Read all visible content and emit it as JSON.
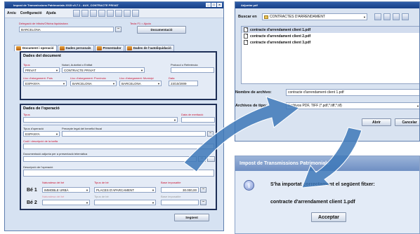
{
  "main_window": {
    "title": "Impost de Transmissions Patrimonials 2015 v3.7.1 - AUX_CONTRACTE PRIVAT",
    "menu": [
      "Arxiu",
      "Configuració",
      "Ajuda"
    ],
    "delegacio_label": "Delegació de tributs/Oficina liquidadora",
    "delegacio_value": "BARCELONA",
    "help_text": "Tecla F1 = Ajuda",
    "documentacio_button": "Documentació",
    "tabs": [
      "Document i operació",
      "Dades personals",
      "Presentador",
      "Dades de l'autoliquidació"
    ],
    "dades_document": {
      "title": "Dades del document",
      "tipus_label": "Tipus",
      "tipus_value": "PRIVAT",
      "notari_label": "Notari, Autoritat o Entitat",
      "notari_value": "CONTRACTE PRIVAT",
      "protocol_label": "Protocol o Referència",
      "lloc_pais_label": "Lloc d'atorgament: País",
      "lloc_pais_value": "ESPANYA",
      "lloc_prov_label": "Lloc d'atorgament: Província",
      "lloc_prov_value": "BARCELONA",
      "lloc_mun_label": "Lloc d'atorgament: Municipi",
      "lloc_mun_value": "BARCELONA",
      "data_label": "Data",
      "data_value": "23/10/2009"
    },
    "dades_operacio": {
      "title": "Dades de l'operació",
      "tipus_label": "Tipus",
      "data_meritacio_label": "Data de meritació",
      "tipus_operacio_label": "Tipus d'operació",
      "tipus_operacio_value": "ESPANYA",
      "precepte_label": "Precepte legal del benefici fiscal",
      "codi_label": "Codi i descripció de la tarifa",
      "doc_adjunta_label": "Documentació adjunta per a presentació telemàtica",
      "descripcio_label": "Descripció de l'operació",
      "naturalesa_label": "Naturalesa del bé",
      "tipus_be_label": "Tipus de bé",
      "base_label": "Base imposable",
      "be1_label": "Bé 1",
      "be1_naturalesa": "IMMOBLE URBÀ",
      "be1_tipus": "PLACES D'APARCAMENT",
      "be1_base": "30.000,00",
      "be2_label": "Bé 2"
    },
    "seguent_button": "Següent"
  },
  "file_dialog": {
    "title": "Adjuntar pdf",
    "buscar_label": "Buscar en",
    "buscar_value": "CONTRACTES D'ARRENDAMENT",
    "files": [
      "contracte d'arrendament client 1.pdf",
      "contracte d'arrendament client 2.pdf",
      "contracte d'arrendament client 3.pdf"
    ],
    "nombre_label": "Nombre de archivo:",
    "nombre_value": "contracte d'arrendament client 1.pdf",
    "archivos_label": "Archivos de tipo:",
    "archivos_value": "Archivos PDF, TIFF (*.pdf,*.tiff,*.tif)",
    "abrir_button": "Abrir",
    "cancelar_button": "Cancelar"
  },
  "message_dialog": {
    "title": "Impost de Transmissions Patrimonials",
    "message": "S'ha importat correctament el següent fitxer:",
    "filename": "contracte d'arrendament client 1.pdf",
    "accept_button": "Acceptar"
  },
  "colors": {
    "arrow": "#3d78b8",
    "panel_border": "#1e2f57",
    "label_red": "#c8102e"
  }
}
